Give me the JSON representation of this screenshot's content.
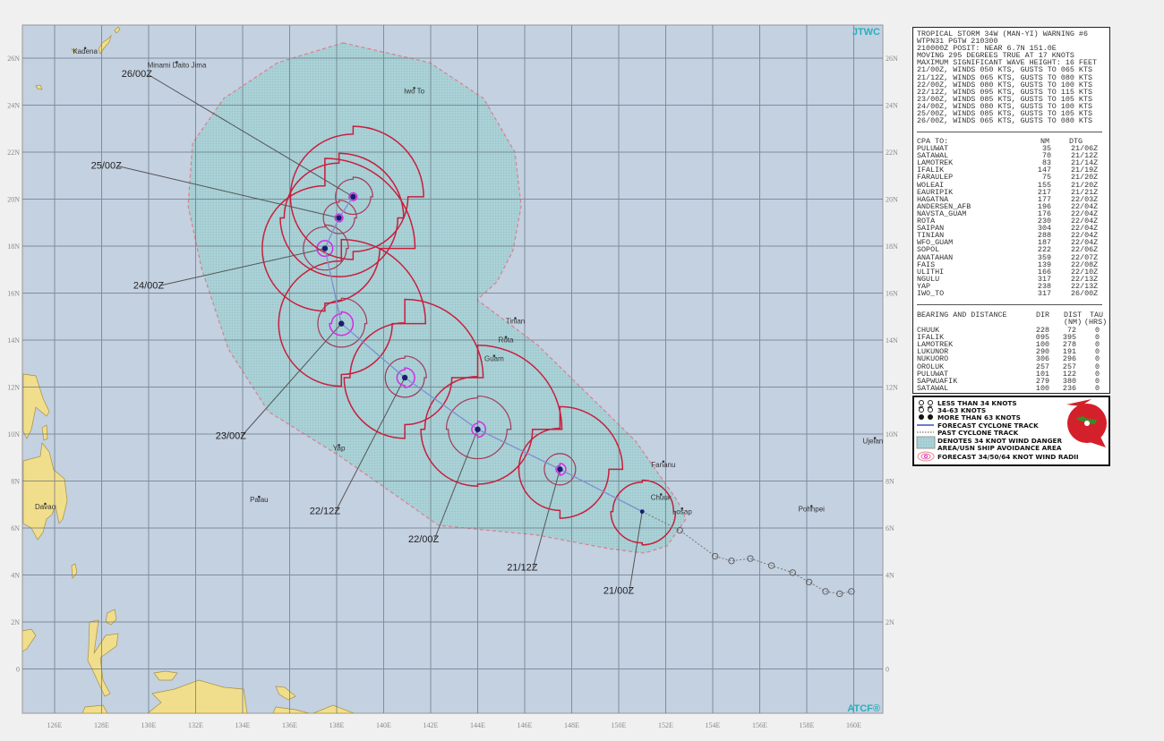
{
  "map": {
    "brand_top": "JTWC",
    "brand_bottom": "ATCF®",
    "lon_ticks": [
      "126E",
      "128E",
      "130E",
      "132E",
      "134E",
      "136E",
      "138E",
      "140E",
      "142E",
      "144E",
      "146E",
      "148E",
      "150E",
      "152E",
      "154E",
      "156E",
      "158E",
      "160E"
    ],
    "lat_ticks": [
      "0",
      "2N",
      "4N",
      "6N",
      "8N",
      "10N",
      "12N",
      "14N",
      "16N",
      "18N",
      "20N",
      "22N",
      "24N",
      "26N"
    ],
    "colors": {
      "ocean": "#c3d1e1",
      "land": "#f1de8c",
      "danger_area": "#a8d2d6",
      "danger_border": "#e07a88",
      "r34": "#c81e3c",
      "r50": "#a43a5a",
      "r64": "#d42ae6",
      "track": "#7d8fd0",
      "center": "#1c1c6e"
    },
    "places": [
      {
        "name": "Kadena",
        "lon": 127.3,
        "lat": 26.2
      },
      {
        "name": "Minami Daito Jima",
        "lon": 131.2,
        "lat": 25.6
      },
      {
        "name": "Iwo To",
        "lon": 141.3,
        "lat": 24.5
      },
      {
        "name": "Tinian",
        "lon": 145.6,
        "lat": 14.7
      },
      {
        "name": "Rota",
        "lon": 145.2,
        "lat": 13.9
      },
      {
        "name": "Guam",
        "lon": 144.7,
        "lat": 13.1
      },
      {
        "name": "Yap",
        "lon": 138.1,
        "lat": 9.3
      },
      {
        "name": "Palau",
        "lon": 134.7,
        "lat": 7.1
      },
      {
        "name": "Davao",
        "lon": 125.6,
        "lat": 6.8
      },
      {
        "name": "Fananu",
        "lon": 151.9,
        "lat": 8.6
      },
      {
        "name": "Chuuk",
        "lon": 151.8,
        "lat": 7.2
      },
      {
        "name": "Losap",
        "lon": 152.7,
        "lat": 6.6
      },
      {
        "name": "Pohnpei",
        "lon": 158.2,
        "lat": 6.7
      },
      {
        "name": "Ujelang",
        "lon": 160.9,
        "lat": 9.6
      }
    ],
    "danger_area": [
      [
        138.27,
        26.65
      ],
      [
        141.96,
        25.81
      ],
      [
        144.25,
        24.29
      ],
      [
        145.58,
        22.0
      ],
      [
        145.85,
        19.71
      ],
      [
        145.5,
        17.81
      ],
      [
        144.82,
        16.48
      ],
      [
        143.98,
        15.71
      ],
      [
        146.53,
        13.81
      ],
      [
        150.72,
        9.7
      ],
      [
        152.51,
        7.14
      ],
      [
        152.86,
        6.38
      ],
      [
        152.06,
        5.24
      ],
      [
        151.1,
        4.93
      ],
      [
        149.58,
        5.12
      ],
      [
        146.53,
        5.7
      ],
      [
        142.34,
        6.11
      ],
      [
        138.15,
        9.05
      ],
      [
        135.1,
        10.95
      ],
      [
        133.39,
        13.62
      ],
      [
        132.25,
        17.05
      ],
      [
        131.68,
        19.71
      ],
      [
        131.87,
        22.38
      ],
      [
        133.2,
        24.29
      ],
      [
        135.49,
        25.81
      ]
    ],
    "past_track": [
      [
        152.6,
        5.9
      ],
      [
        154.1,
        4.8
      ],
      [
        154.8,
        4.6
      ],
      [
        155.6,
        4.7
      ],
      [
        156.5,
        4.4
      ],
      [
        157.4,
        4.1
      ],
      [
        158.1,
        3.7
      ],
      [
        158.8,
        3.3
      ],
      [
        159.4,
        3.2
      ],
      [
        159.9,
        3.3
      ]
    ],
    "forecast": [
      {
        "dtg": "21/00Z",
        "lon": 151.0,
        "lat": 6.7,
        "r34": [
          80,
          85,
          80,
          75
        ],
        "r50": null,
        "r64": null,
        "label_lon": 150.0,
        "label_lat": 3.2
      },
      {
        "dtg": "21/12Z",
        "lon": 147.5,
        "lat": 8.5,
        "r34": [
          160,
          125,
          105,
          105
        ],
        "r50": [
          40,
          40,
          40,
          40
        ],
        "r64": [
          15,
          15,
          10,
          10
        ],
        "label_lon": 145.9,
        "label_lat": 4.2
      },
      {
        "dtg": "22/00Z",
        "lon": 144.0,
        "lat": 10.2,
        "r34": [
          215,
          140,
          145,
          135
        ],
        "r50": [
          85,
          75,
          75,
          80
        ],
        "r64": [
          20,
          20,
          15,
          15
        ],
        "label_lon": 141.7,
        "label_lat": 5.4
      },
      {
        "dtg": "22/12Z",
        "lon": 140.9,
        "lat": 12.4,
        "r34": [
          200,
          120,
          155,
          140
        ],
        "r50": [
          55,
          50,
          50,
          50
        ],
        "r64": [
          25,
          25,
          20,
          20
        ],
        "label_lon": 137.5,
        "label_lat": 6.6
      },
      {
        "dtg": "23/00Z",
        "lon": 138.2,
        "lat": 14.7,
        "r34": [
          215,
          130,
          160,
          160
        ],
        "r50": [
          65,
          60,
          60,
          60
        ],
        "r64": [
          30,
          30,
          30,
          25
        ],
        "label_lon": 133.5,
        "label_lat": 9.8
      },
      {
        "dtg": "24/00Z",
        "lon": 137.5,
        "lat": 17.9,
        "r34": [
          230,
          140,
          160,
          160
        ],
        "r50": [
          60,
          55,
          55,
          55
        ],
        "r64": [
          20,
          20,
          20,
          20
        ],
        "label_lon": 130.0,
        "label_lat": 16.2
      },
      {
        "dtg": "25/00Z",
        "lon": 138.1,
        "lat": 19.2,
        "r34": [
          165,
          150,
          150,
          140
        ],
        "r50": [
          45,
          40,
          40,
          40
        ],
        "r64": [
          10,
          10,
          10,
          10
        ],
        "label_lon": 128.2,
        "label_lat": 21.3
      },
      {
        "dtg": "26/00Z",
        "lon": 138.7,
        "lat": 20.1,
        "r34": [
          180,
          140,
          160,
          160
        ],
        "r50": [
          50,
          45,
          45,
          45
        ],
        "r64": [
          10,
          10,
          10,
          10
        ],
        "label_lon": 129.5,
        "label_lat": 25.2
      }
    ]
  },
  "warning": {
    "lines": [
      "TROPICAL STORM 34W (MAN-YI) WARNING #6",
      "WTPN31 PGTW 210300",
      "210000Z POSIT: NEAR 6.7N 151.0E",
      "MOVING 295 DEGREES TRUE AT 17 KNOTS",
      "MAXIMUM SIGNIFICANT WAVE HEIGHT: 16 FEET",
      "21/00Z, WINDS 050 KTS, GUSTS TO 065 KTS",
      "21/12Z, WINDS 065 KTS, GUSTS TO 080 KTS",
      "22/00Z, WINDS 080 KTS, GUSTS TO 100 KTS",
      "22/12Z, WINDS 095 KTS, GUSTS TO 115 KTS",
      "23/00Z, WINDS 085 KTS, GUSTS TO 105 KTS",
      "24/00Z, WINDS 080 KTS, GUSTS TO 100 KTS",
      "25/00Z, WINDS 085 KTS, GUSTS TO 105 KTS",
      "26/00Z, WINDS 065 KTS, GUSTS TO 080 KTS"
    ]
  },
  "cpa": {
    "title": "CPA TO:",
    "col_nm": "NM",
    "col_dtg": "DTG",
    "rows": [
      [
        "PULUWAT",
        "35",
        "21/06Z"
      ],
      [
        "SATAWAL",
        "70",
        "21/12Z"
      ],
      [
        "LAMOTREK",
        "83",
        "21/14Z"
      ],
      [
        "IFALIK",
        "147",
        "21/19Z"
      ],
      [
        "FARAULEP",
        "75",
        "21/20Z"
      ],
      [
        "WOLEAI",
        "155",
        "21/20Z"
      ],
      [
        "EAURIPIK",
        "217",
        "21/21Z"
      ],
      [
        "HAGATNA",
        "177",
        "22/03Z"
      ],
      [
        "ANDERSEN_AFB",
        "196",
        "22/04Z"
      ],
      [
        "NAVSTA_GUAM",
        "176",
        "22/04Z"
      ],
      [
        "ROTA",
        "230",
        "22/04Z"
      ],
      [
        "SAIPAN",
        "304",
        "22/04Z"
      ],
      [
        "TINIAN",
        "288",
        "22/04Z"
      ],
      [
        "WFO_GUAM",
        "187",
        "22/04Z"
      ],
      [
        "SOPOL",
        "222",
        "22/06Z"
      ],
      [
        "ANATAHAN",
        "359",
        "22/07Z"
      ],
      [
        "FAIS",
        "139",
        "22/08Z"
      ],
      [
        "ULITHI",
        "166",
        "22/10Z"
      ],
      [
        "NGULU",
        "317",
        "22/13Z"
      ],
      [
        "YAP",
        "238",
        "22/13Z"
      ],
      [
        "IWO_TO",
        "317",
        "26/00Z"
      ]
    ]
  },
  "bearing": {
    "title": "BEARING AND DISTANCE",
    "col_dir": "DIR",
    "col_dist": "DIST",
    "col_tau": "TAU",
    "unit_dist": "(NM)",
    "unit_tau": "(HRS)",
    "rows": [
      [
        "CHUUK",
        "228",
        "72",
        "0"
      ],
      [
        "IFALIK",
        "095",
        "395",
        "0"
      ],
      [
        "LAMOTREK",
        "100",
        "278",
        "0"
      ],
      [
        "LUKUNOR",
        "290",
        "191",
        "0"
      ],
      [
        "NUKUORO",
        "306",
        "296",
        "0"
      ],
      [
        "OROLUK",
        "257",
        "257",
        "0"
      ],
      [
        "PULUWAT",
        "101",
        "122",
        "0"
      ],
      [
        "SAPWUAFIK",
        "279",
        "380",
        "0"
      ],
      [
        "SATAWAL",
        "100",
        "236",
        "0"
      ]
    ]
  },
  "legend": {
    "items": [
      "LESS THAN 34 KNOTS",
      "34-63 KNOTS",
      "MORE THAN 63 KNOTS",
      "FORECAST CYCLONE TRACK",
      "PAST CYCLONE TRACK",
      "DENOTES 34 KNOT WIND DANGER",
      "AREA/USN SHIP AVOIDANCE AREA",
      "FORECAST 34/50/64 KNOT WIND RADII"
    ]
  }
}
